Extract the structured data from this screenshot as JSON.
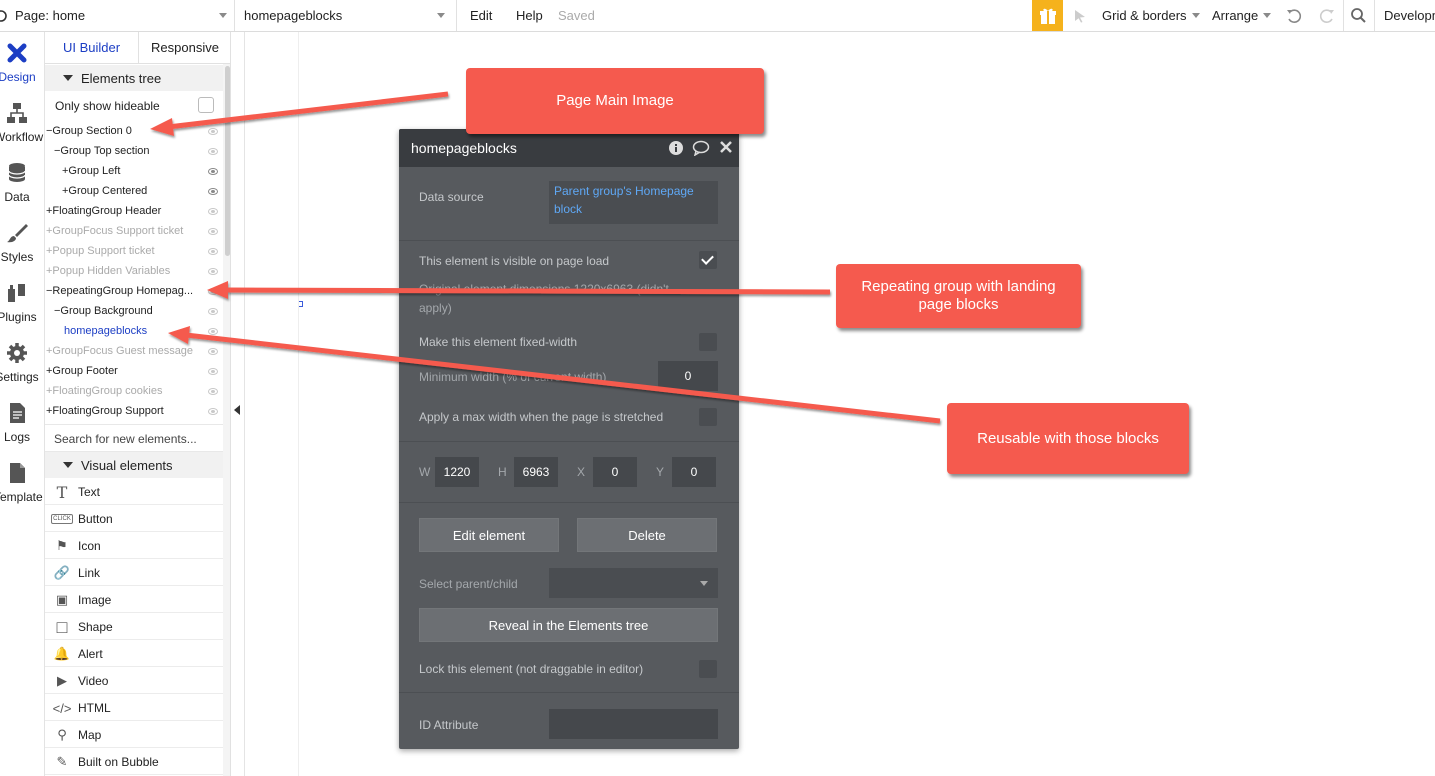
{
  "topbar": {
    "page_selector": "Page: home",
    "element_selector": "homepageblocks",
    "menu_edit": "Edit",
    "menu_help": "Help",
    "saved_status": "Saved",
    "grid_borders": "Grid & borders",
    "arrange": "Arrange",
    "environment": "Developm",
    "accent_color": "#f5b21c"
  },
  "rail": {
    "items": [
      {
        "label": "Design",
        "icon": "design-icon"
      },
      {
        "label": "Workflow",
        "icon": "workflow-icon"
      },
      {
        "label": "Data",
        "icon": "database-icon"
      },
      {
        "label": "Styles",
        "icon": "brush-icon"
      },
      {
        "label": "Plugins",
        "icon": "plug-icon"
      },
      {
        "label": "Settings",
        "icon": "gear-icon"
      },
      {
        "label": "Logs",
        "icon": "document-icon"
      },
      {
        "label": "Template",
        "icon": "template-icon"
      }
    ]
  },
  "panel": {
    "tab_builder": "UI Builder",
    "tab_responsive": "Responsive",
    "elements_tree_title": "Elements tree",
    "only_hideable": "Only show hideable",
    "tree": [
      {
        "prefix": "−",
        "label": "Group Section 0"
      },
      {
        "prefix": "−",
        "label": "Group Top section"
      },
      {
        "prefix": "+",
        "label": "Group Left"
      },
      {
        "prefix": "+",
        "label": "Group Centered"
      },
      {
        "prefix": "+",
        "label": "FloatingGroup Header"
      },
      {
        "prefix": "+",
        "label": "GroupFocus Support ticket"
      },
      {
        "prefix": "+",
        "label": "Popup Support ticket"
      },
      {
        "prefix": "+",
        "label": "Popup Hidden Variables"
      },
      {
        "prefix": "−",
        "label": "RepeatingGroup Homepag..."
      },
      {
        "prefix": "−",
        "label": "Group Background"
      },
      {
        "prefix": "",
        "label": "homepageblocks"
      },
      {
        "prefix": "+",
        "label": "GroupFocus Guest message"
      },
      {
        "prefix": "+",
        "label": "Group Footer"
      },
      {
        "prefix": "+",
        "label": "FloatingGroup cookies"
      },
      {
        "prefix": "+",
        "label": "FloatingGroup Support"
      }
    ],
    "search_placeholder": "Search for new elements...",
    "visual_elements_title": "Visual elements",
    "visual_elements": [
      {
        "label": "Text",
        "icon": "T"
      },
      {
        "label": "Button",
        "icon": "CLICK"
      },
      {
        "label": "Icon",
        "icon": "⚑"
      },
      {
        "label": "Link",
        "icon": "🔗"
      },
      {
        "label": "Image",
        "icon": "▣"
      },
      {
        "label": "Shape",
        "icon": "□"
      },
      {
        "label": "Alert",
        "icon": "🔔"
      },
      {
        "label": "Video",
        "icon": "▶"
      },
      {
        "label": "HTML",
        "icon": "</>"
      },
      {
        "label": "Map",
        "icon": "⚲"
      },
      {
        "label": "Built on Bubble",
        "icon": "✎"
      }
    ]
  },
  "editor": {
    "title": "homepageblocks",
    "data_source_label": "Data source",
    "data_source_value": "Parent group's Homepage block",
    "visible_label": "This element is visible on page load",
    "original_label_1": "Original element dimensions 1220x6963 (didn't",
    "original_label_2": "apply)",
    "fixed_width_label": "Make this element fixed-width",
    "min_width_label": "Minimum width (% of current width)",
    "min_width_value": "0",
    "max_width_label": "Apply a max width when the page is stretched",
    "w_label": "W",
    "w_value": "1220",
    "h_label": "H",
    "h_value": "6963",
    "x_label": "X",
    "x_value": "0",
    "y_label": "Y",
    "y_value": "0",
    "edit_button": "Edit element",
    "delete_button": "Delete",
    "parent_child_label": "Select parent/child",
    "reveal_button": "Reveal in the Elements tree",
    "lock_label": "Lock this element (not draggable in editor)",
    "id_attribute_label": "ID Attribute"
  },
  "annotations": {
    "callout_1": "Page Main Image",
    "callout_2": "Repeating group with landing page blocks",
    "callout_3": "Reusable with those blocks",
    "color": "#f55a4e"
  }
}
